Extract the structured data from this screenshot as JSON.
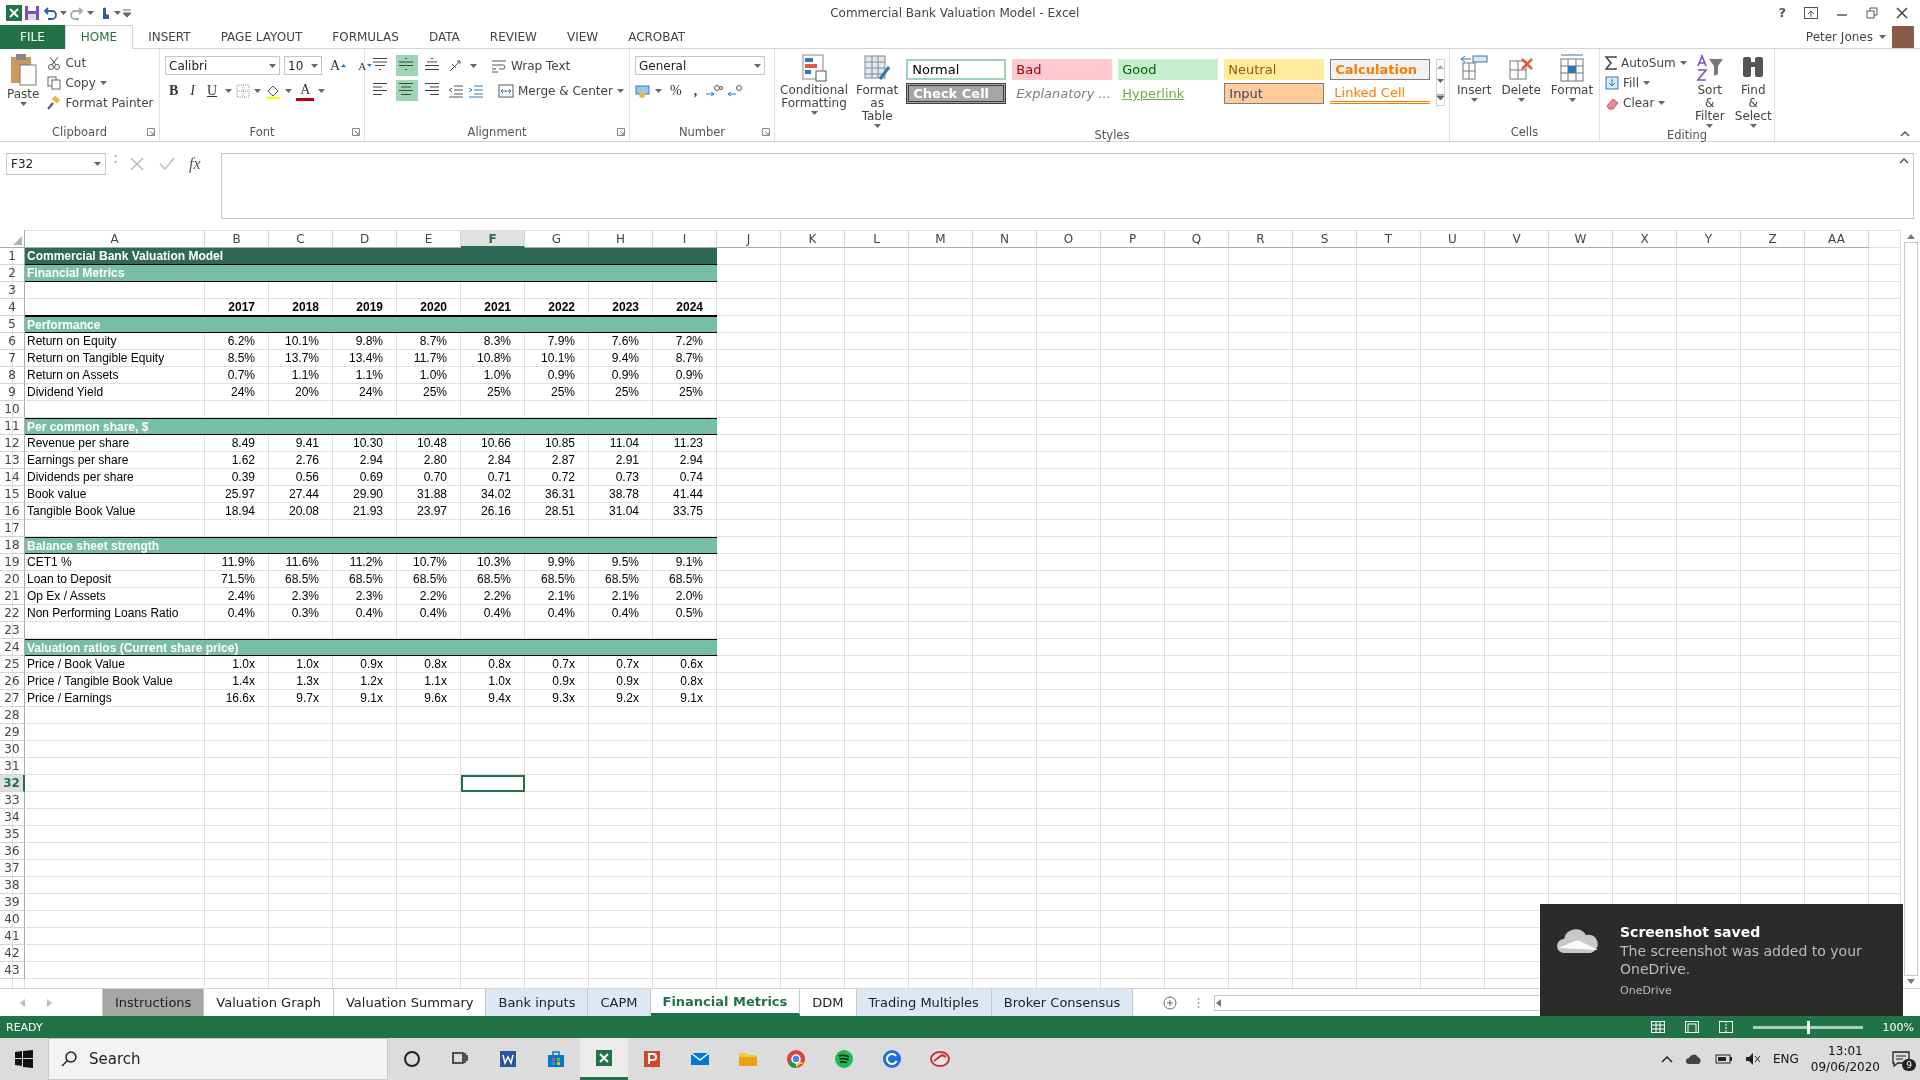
{
  "window": {
    "title": "Commercial Bank Valuation Model - Excel",
    "user": "Peter Jones",
    "help": "?"
  },
  "ribbon_tabs": [
    {
      "label": "FILE",
      "kind": "file",
      "selected": false
    },
    {
      "label": "HOME",
      "kind": "tab",
      "selected": true
    },
    {
      "label": "INSERT",
      "kind": "tab",
      "selected": false
    },
    {
      "label": "PAGE LAYOUT",
      "kind": "tab",
      "selected": false
    },
    {
      "label": "FORMULAS",
      "kind": "tab",
      "selected": false
    },
    {
      "label": "DATA",
      "kind": "tab",
      "selected": false
    },
    {
      "label": "REVIEW",
      "kind": "tab",
      "selected": false
    },
    {
      "label": "VIEW",
      "kind": "tab",
      "selected": false
    },
    {
      "label": "ACROBAT",
      "kind": "tab",
      "selected": false
    }
  ],
  "clipboard": {
    "label": "Clipboard",
    "paste": "Paste",
    "cut": "Cut",
    "copy": "Copy",
    "format_painter": "Format Painter"
  },
  "font": {
    "label": "Font",
    "name": "Calibri",
    "size": "10",
    "grow": "A",
    "shrink": "A",
    "bold": "B",
    "italic": "I",
    "underline": "U",
    "font_color_button": "A"
  },
  "alignment": {
    "label": "Alignment",
    "wrap": "Wrap Text",
    "merge": "Merge & Center",
    "vertical": [
      {
        "kind": "top",
        "selected": false
      },
      {
        "kind": "middle",
        "selected": true
      },
      {
        "kind": "bottom",
        "selected": false
      }
    ],
    "horizontal": [
      {
        "kind": "left",
        "selected": false
      },
      {
        "kind": "center",
        "selected": true
      },
      {
        "kind": "right",
        "selected": false
      }
    ]
  },
  "number": {
    "label": "Number",
    "format": "General",
    "percent": "%",
    "comma": ","
  },
  "styles": {
    "label": "Styles",
    "conditional": "Conditional Formatting",
    "format_table": "Format as Table",
    "cells": [
      {
        "label": "Normal",
        "kind": "normal"
      },
      {
        "label": "Bad",
        "kind": "bad"
      },
      {
        "label": "Good",
        "kind": "good"
      },
      {
        "label": "Neutral",
        "kind": "neutral"
      },
      {
        "label": "Calculation",
        "kind": "calculation"
      },
      {
        "label": "Check Cell",
        "kind": "check"
      },
      {
        "label": "Explanatory ...",
        "kind": "explanatory"
      },
      {
        "label": "Hyperlink",
        "kind": "hyperlink"
      },
      {
        "label": "Input",
        "kind": "input"
      },
      {
        "label": "Linked Cell",
        "kind": "linked"
      }
    ]
  },
  "cells": {
    "label": "Cells",
    "insert": "Insert",
    "delete": "Delete",
    "format": "Format"
  },
  "editing": {
    "label": "Editing",
    "autosum": "AutoSum",
    "fill": "Fill",
    "clear": "Clear",
    "sort": "Sort & Filter",
    "find": "Find & Select"
  },
  "formula_bar": {
    "name_box": "F32",
    "function_label": "fx"
  },
  "sheet": {
    "columns": [
      {
        "label": "A",
        "selected": false
      },
      {
        "label": "B",
        "selected": false
      },
      {
        "label": "C",
        "selected": false
      },
      {
        "label": "D",
        "selected": false
      },
      {
        "label": "E",
        "selected": false
      },
      {
        "label": "F",
        "selected": true
      },
      {
        "label": "G",
        "selected": false
      },
      {
        "label": "H",
        "selected": false
      },
      {
        "label": "I",
        "selected": false
      },
      {
        "label": "J",
        "selected": false
      },
      {
        "label": "K",
        "selected": false
      },
      {
        "label": "L",
        "selected": false
      },
      {
        "label": "M",
        "selected": false
      },
      {
        "label": "N",
        "selected": false
      },
      {
        "label": "O",
        "selected": false
      },
      {
        "label": "P",
        "selected": false
      },
      {
        "label": "Q",
        "selected": false
      },
      {
        "label": "R",
        "selected": false
      },
      {
        "label": "S",
        "selected": false
      },
      {
        "label": "T",
        "selected": false
      },
      {
        "label": "U",
        "selected": false
      },
      {
        "label": "V",
        "selected": false
      },
      {
        "label": "W",
        "selected": false
      },
      {
        "label": "X",
        "selected": false
      },
      {
        "label": "Y",
        "selected": false
      },
      {
        "label": "Z",
        "selected": false
      },
      {
        "label": "AA",
        "selected": false
      }
    ],
    "rows": [
      {
        "label": "1",
        "selected": false,
        "kind": "title",
        "text": "Commercial Bank Valuation Model"
      },
      {
        "label": "2",
        "selected": false,
        "kind": "subtitle",
        "text": "Financial Metrics"
      },
      {
        "label": "3",
        "selected": false,
        "kind": "blank"
      },
      {
        "label": "4",
        "selected": false,
        "kind": "header",
        "values": [
          "2017",
          "2018",
          "2019",
          "2020",
          "2021",
          "2022",
          "2023",
          "2024"
        ]
      },
      {
        "label": "5",
        "selected": false,
        "kind": "section",
        "text": "Performance"
      },
      {
        "label": "6",
        "selected": false,
        "kind": "data",
        "name": "Return on Equity",
        "values": [
          "6.2%",
          "10.1%",
          "9.8%",
          "8.7%",
          "8.3%",
          "7.9%",
          "7.6%",
          "7.2%"
        ]
      },
      {
        "label": "7",
        "selected": false,
        "kind": "data",
        "name": "Return on Tangible Equity",
        "values": [
          "8.5%",
          "13.7%",
          "13.4%",
          "11.7%",
          "10.8%",
          "10.1%",
          "9.4%",
          "8.7%"
        ]
      },
      {
        "label": "8",
        "selected": false,
        "kind": "data",
        "name": "Return on Assets",
        "values": [
          "0.7%",
          "1.1%",
          "1.1%",
          "1.0%",
          "1.0%",
          "0.9%",
          "0.9%",
          "0.9%"
        ]
      },
      {
        "label": "9",
        "selected": false,
        "kind": "data",
        "name": "Dividend Yield",
        "values": [
          "24%",
          "20%",
          "24%",
          "25%",
          "25%",
          "25%",
          "25%",
          "25%"
        ]
      },
      {
        "label": "10",
        "selected": false,
        "kind": "blank"
      },
      {
        "label": "11",
        "selected": false,
        "kind": "section",
        "text": "Per common share, $"
      },
      {
        "label": "12",
        "selected": false,
        "kind": "data",
        "name": "Revenue per share",
        "values": [
          "8.49",
          "9.41",
          "10.30",
          "10.48",
          "10.66",
          "10.85",
          "11.04",
          "11.23"
        ]
      },
      {
        "label": "13",
        "selected": false,
        "kind": "data",
        "name": "Earnings per share",
        "values": [
          "1.62",
          "2.76",
          "2.94",
          "2.80",
          "2.84",
          "2.87",
          "2.91",
          "2.94"
        ]
      },
      {
        "label": "14",
        "selected": false,
        "kind": "data",
        "name": "Dividends per share",
        "values": [
          "0.39",
          "0.56",
          "0.69",
          "0.70",
          "0.71",
          "0.72",
          "0.73",
          "0.74"
        ]
      },
      {
        "label": "15",
        "selected": false,
        "kind": "data",
        "name": "Book value",
        "values": [
          "25.97",
          "27.44",
          "29.90",
          "31.88",
          "34.02",
          "36.31",
          "38.78",
          "41.44"
        ]
      },
      {
        "label": "16",
        "selected": false,
        "kind": "data",
        "name": "Tangible Book Value",
        "values": [
          "18.94",
          "20.08",
          "21.93",
          "23.97",
          "26.16",
          "28.51",
          "31.04",
          "33.75"
        ]
      },
      {
        "label": "17",
        "selected": false,
        "kind": "blank"
      },
      {
        "label": "18",
        "selected": false,
        "kind": "section",
        "text": "Balance sheet strength"
      },
      {
        "label": "19",
        "selected": false,
        "kind": "data",
        "name": "CET1 %",
        "values": [
          "11.9%",
          "11.6%",
          "11.2%",
          "10.7%",
          "10.3%",
          "9.9%",
          "9.5%",
          "9.1%"
        ]
      },
      {
        "label": "20",
        "selected": false,
        "kind": "data",
        "name": "Loan to Deposit",
        "values": [
          "71.5%",
          "68.5%",
          "68.5%",
          "68.5%",
          "68.5%",
          "68.5%",
          "68.5%",
          "68.5%"
        ]
      },
      {
        "label": "21",
        "selected": false,
        "kind": "data",
        "name": "Op Ex / Assets",
        "values": [
          "2.4%",
          "2.3%",
          "2.3%",
          "2.2%",
          "2.2%",
          "2.1%",
          "2.1%",
          "2.0%"
        ]
      },
      {
        "label": "22",
        "selected": false,
        "kind": "data",
        "name": "Non Performing Loans Ratio",
        "values": [
          "0.4%",
          "0.3%",
          "0.4%",
          "0.4%",
          "0.4%",
          "0.4%",
          "0.4%",
          "0.5%"
        ]
      },
      {
        "label": "23",
        "selected": false,
        "kind": "blank"
      },
      {
        "label": "24",
        "selected": false,
        "kind": "section",
        "text": "Valuation ratios (Current share price)"
      },
      {
        "label": "25",
        "selected": false,
        "kind": "data",
        "name": "Price / Book Value",
        "values": [
          "1.0x",
          "1.0x",
          "0.9x",
          "0.8x",
          "0.8x",
          "0.7x",
          "0.7x",
          "0.6x"
        ]
      },
      {
        "label": "26",
        "selected": false,
        "kind": "data",
        "name": "Price / Tangible Book Value",
        "values": [
          "1.4x",
          "1.3x",
          "1.2x",
          "1.1x",
          "1.0x",
          "0.9x",
          "0.9x",
          "0.8x"
        ]
      },
      {
        "label": "27",
        "selected": false,
        "kind": "data",
        "name": "Price / Earnings",
        "values": [
          "16.6x",
          "9.7x",
          "9.1x",
          "9.6x",
          "9.4x",
          "9.3x",
          "9.2x",
          "9.1x"
        ]
      },
      {
        "label": "28",
        "selected": false,
        "kind": "blank"
      },
      {
        "label": "29",
        "selected": false,
        "kind": "blank"
      },
      {
        "label": "30",
        "selected": false,
        "kind": "blank"
      },
      {
        "label": "31",
        "selected": false,
        "kind": "blank"
      },
      {
        "label": "32",
        "selected": true,
        "kind": "blank"
      },
      {
        "label": "33",
        "selected": false,
        "kind": "blank"
      },
      {
        "label": "34",
        "selected": false,
        "kind": "blank"
      },
      {
        "label": "35",
        "selected": false,
        "kind": "blank"
      },
      {
        "label": "36",
        "selected": false,
        "kind": "blank"
      },
      {
        "label": "37",
        "selected": false,
        "kind": "blank"
      },
      {
        "label": "38",
        "selected": false,
        "kind": "blank"
      },
      {
        "label": "39",
        "selected": false,
        "kind": "blank"
      },
      {
        "label": "40",
        "selected": false,
        "kind": "blank"
      },
      {
        "label": "41",
        "selected": false,
        "kind": "blank"
      },
      {
        "label": "42",
        "selected": false,
        "kind": "blank"
      },
      {
        "label": "43",
        "selected": false,
        "kind": "blank"
      }
    ]
  },
  "sheet_tabs": [
    {
      "label": "Instructions",
      "selected": false,
      "color": "#a6a6a6"
    },
    {
      "label": "Valuation Graph",
      "selected": false
    },
    {
      "label": "Valuation Summary",
      "selected": false
    },
    {
      "label": "Bank inputs",
      "selected": false,
      "color": "#dce9f5"
    },
    {
      "label": "CAPM",
      "selected": false,
      "color": "#dce9f5"
    },
    {
      "label": "Financial Metrics",
      "selected": true
    },
    {
      "label": "DDM",
      "selected": false
    },
    {
      "label": "Trading Multiples",
      "selected": false,
      "color": "#dce9f5"
    },
    {
      "label": "Broker Consensus",
      "selected": false,
      "color": "#dce9f5"
    }
  ],
  "status_bar": {
    "status": "READY",
    "zoom": "100%",
    "zoom_slider": {
      "level": 0.5
    }
  },
  "notification": {
    "title": "Screenshot saved",
    "message": "The screenshot was added to your OneDrive.",
    "source": "OneDrive"
  },
  "taskbar": {
    "search": "Search",
    "apps": [
      {
        "kind": "cortana",
        "selected": false
      },
      {
        "kind": "taskview",
        "selected": false
      },
      {
        "kind": "word",
        "selected": false
      },
      {
        "kind": "store",
        "selected": false
      },
      {
        "kind": "excel",
        "selected": true
      },
      {
        "kind": "powerpoint",
        "selected": false
      },
      {
        "kind": "mail",
        "selected": false
      },
      {
        "kind": "explorer",
        "selected": false
      },
      {
        "kind": "chrome",
        "selected": false
      },
      {
        "kind": "spotify",
        "selected": false
      },
      {
        "kind": "swirl",
        "selected": false
      },
      {
        "kind": "paint",
        "selected": false
      }
    ],
    "language": "ENG",
    "time": "13:01",
    "date": "09/06/2020",
    "notifications": "9"
  }
}
